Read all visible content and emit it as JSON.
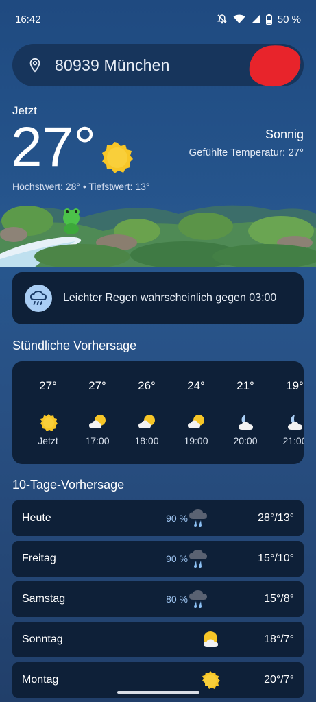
{
  "status_bar": {
    "time": "16:42",
    "battery": "50 %"
  },
  "search": {
    "location": "80939 München"
  },
  "current": {
    "now_label": "Jetzt",
    "temperature": "27°",
    "condition": "Sonnig",
    "feels_like": "Gefühlte Temperatur: 27°",
    "high_low": "Höchstwert: 28° • Tiefstwert: 13°"
  },
  "alert": {
    "text": "Leichter Regen wahrscheinlich gegen 03:00",
    "icon": "rain-cloud-icon"
  },
  "hourly": {
    "title": "Stündliche Vorhersage",
    "items": [
      {
        "temp": "27°",
        "time": "Jetzt",
        "icon": "sun-icon"
      },
      {
        "temp": "27°",
        "time": "17:00",
        "icon": "partly-cloudy-icon"
      },
      {
        "temp": "26°",
        "time": "18:00",
        "icon": "partly-cloudy-icon"
      },
      {
        "temp": "24°",
        "time": "19:00",
        "icon": "partly-cloudy-icon"
      },
      {
        "temp": "21°",
        "time": "20:00",
        "icon": "moon-cloud-icon"
      },
      {
        "temp": "19°",
        "time": "21:00",
        "icon": "moon-cloud-icon"
      }
    ]
  },
  "daily": {
    "title": "10-Tage-Vorhersage",
    "items": [
      {
        "day": "Heute",
        "precip": "90 %",
        "temps": "28°/13°",
        "icon": "rain-storm-icon"
      },
      {
        "day": "Freitag",
        "precip": "90 %",
        "temps": "15°/10°",
        "icon": "rain-storm-icon"
      },
      {
        "day": "Samstag",
        "precip": "80 %",
        "temps": "15°/8°",
        "icon": "rain-storm-icon"
      },
      {
        "day": "Sonntag",
        "precip": "",
        "temps": "18°/7°",
        "icon": "partly-cloudy-icon"
      },
      {
        "day": "Montag",
        "precip": "",
        "temps": "20°/7°",
        "icon": "sun-icon"
      }
    ]
  },
  "colors": {
    "card": "#0e2038",
    "accent_blue": "#9ec4f0",
    "sun": "#f7c627"
  }
}
